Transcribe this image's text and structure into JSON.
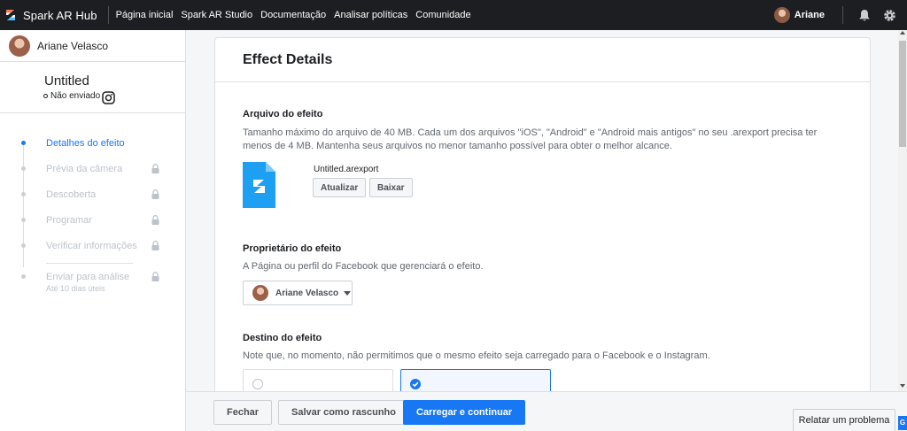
{
  "colors": {
    "accent": "#1877f2",
    "topbar": "#1c1e21"
  },
  "topbar": {
    "brand": "Spark AR Hub",
    "nav": [
      "Página inicial",
      "Spark AR Studio",
      "Documentação",
      "Analisar políticas",
      "Comunidade"
    ],
    "user": "Ariane",
    "icons": [
      "bell-icon",
      "gear-icon"
    ]
  },
  "sidebar": {
    "user_name": "Ariane Velasco",
    "effect_title": "Untitled",
    "effect_status": "Não enviado",
    "platform_icon": "instagram-icon",
    "steps": [
      {
        "label": "Detalhes do efeito",
        "active": true,
        "locked": false
      },
      {
        "label": "Prévia da câmera",
        "active": false,
        "locked": true
      },
      {
        "label": "Descoberta",
        "active": false,
        "locked": true
      },
      {
        "label": "Programar",
        "active": false,
        "locked": true
      },
      {
        "label": "Verificar informações",
        "active": false,
        "locked": true
      },
      {
        "label": "Enviar para análise",
        "sub": "Até 10 dias úteis",
        "active": false,
        "locked": true
      }
    ]
  },
  "main": {
    "title": "Effect Details",
    "file_section": {
      "title": "Arquivo do efeito",
      "description": "Tamanho máximo do arquivo de 40 MB. Cada um dos arquivos \"iOS\", \"Android\" e \"Android mais antigos\" no seu .arexport precisa ter menos de 4 MB. Mantenha seus arquivos no menor tamanho possível para obter o melhor alcance.",
      "file_name": "Untitled.arexport",
      "update_label": "Atualizar",
      "download_label": "Baixar"
    },
    "owner_section": {
      "title": "Proprietário do efeito",
      "description": "A Página ou perfil do Facebook que gerenciará o efeito.",
      "selected_owner": "Ariane Velasco"
    },
    "destination_section": {
      "title": "Destino do efeito",
      "description": "Note que, no momento, não permitimos que o mesmo efeito seja carregado para o Facebook e o Instagram."
    }
  },
  "footer": {
    "close_label": "Fechar",
    "save_draft_label": "Salvar como rascunho",
    "upload_label": "Carregar e continuar",
    "report_label": "Relatar um problema",
    "badge": "G"
  }
}
